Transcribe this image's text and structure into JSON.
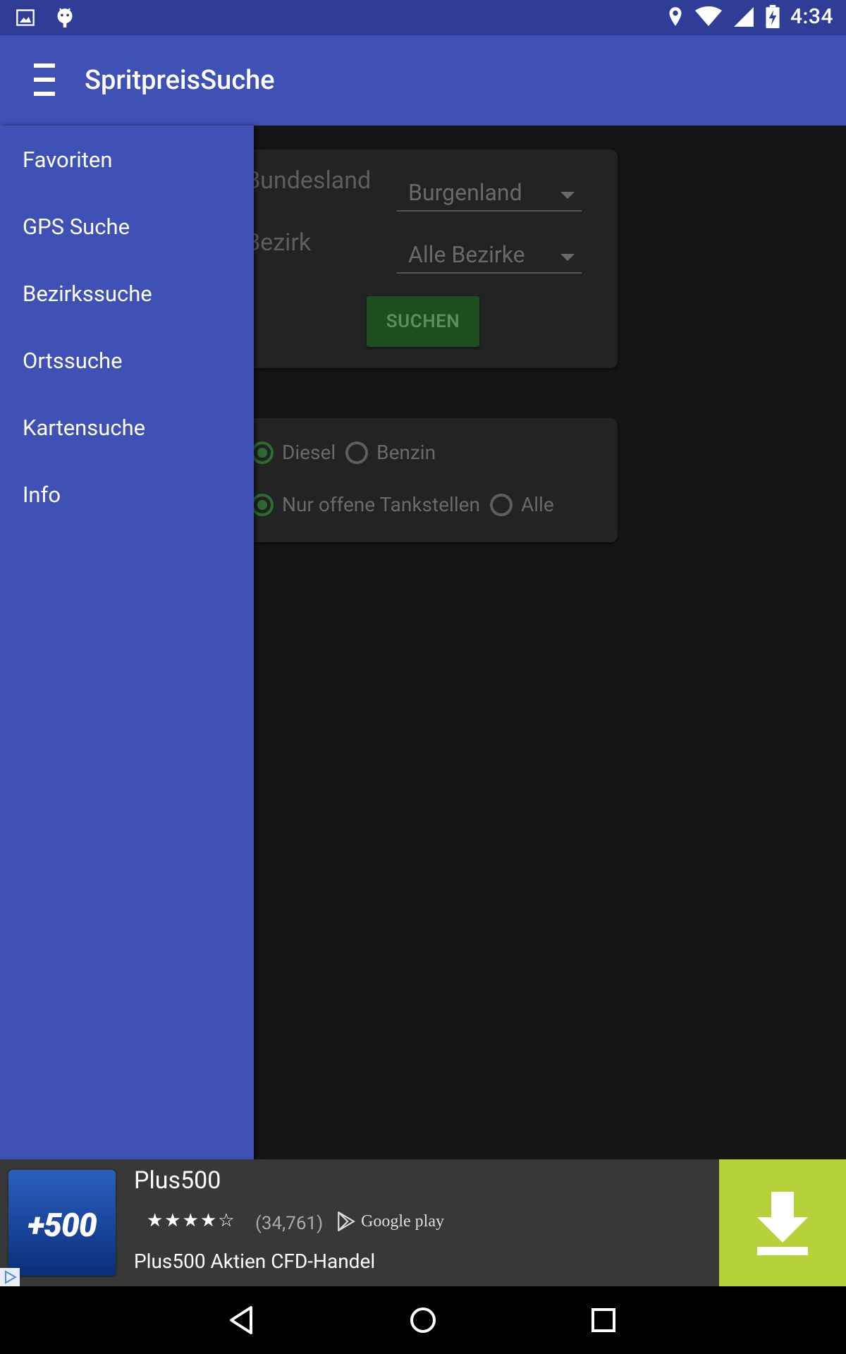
{
  "status_bar": {
    "time": "4:34",
    "left_icons": [
      "image-icon",
      "android-icon"
    ],
    "right_icons": [
      "location-icon",
      "wifi-icon",
      "signal-icon",
      "battery-charging-icon"
    ]
  },
  "app_bar": {
    "title": "SpritpreisSuche",
    "menu_icon": "hamburger-menu-icon"
  },
  "drawer": {
    "items": [
      {
        "label": "Favoriten"
      },
      {
        "label": "GPS Suche"
      },
      {
        "label": "Bezirkssuche"
      },
      {
        "label": "Ortssuche"
      },
      {
        "label": "Kartensuche"
      },
      {
        "label": "Info"
      }
    ]
  },
  "search_card": {
    "bundesland_label": "Bundesland",
    "bundesland_value": "Burgenland",
    "bezirk_label": "Bezirk",
    "bezirk_value": "Alle Bezirke",
    "search_button": "SUCHEN"
  },
  "filter_card": {
    "fuel_options": [
      {
        "label": "Diesel",
        "selected": true
      },
      {
        "label": "Benzin",
        "selected": false
      }
    ],
    "station_options": [
      {
        "label": "Nur offene Tankstellen",
        "selected": true
      },
      {
        "label": "Alle",
        "selected": false
      }
    ]
  },
  "ad": {
    "logo_text": "+500",
    "title": "Plus500",
    "rating": "★★★★☆",
    "rating_count": "(34,761)",
    "store_name": "Google play",
    "description": "Plus500 Aktien CFD-Handel",
    "download_icon": "download-icon",
    "accent_color": "#b5d23b"
  },
  "colors": {
    "primary": "#3f51b5",
    "primary_dark": "#2f3d96",
    "accent_green": "#2e6b30"
  },
  "nav_bar": {
    "buttons": [
      "back-icon",
      "home-icon",
      "recents-icon"
    ]
  }
}
